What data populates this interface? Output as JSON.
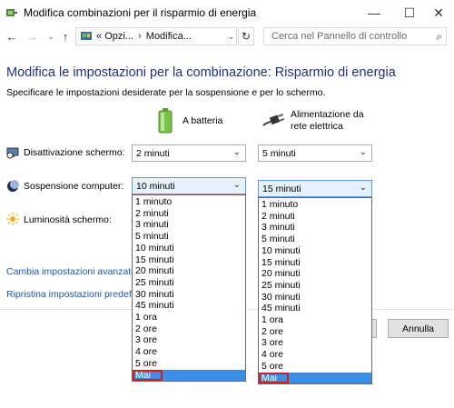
{
  "window": {
    "title": "Modifica combinazioni per il risparmio di energia",
    "minimize_glyph": "—",
    "maximize_glyph": "☐",
    "close_glyph": "✕"
  },
  "nav": {
    "back_glyph": "←",
    "forward_glyph": "→",
    "recent_glyph": "⌄",
    "up_glyph": "↑",
    "address_prefix": "«",
    "crumb1": "Opzi...",
    "crumb_sep": "›",
    "crumb2": "Modifica...",
    "address_dropdown_glyph": "⌄",
    "refresh_glyph": "↻",
    "search_placeholder": "Cerca nel Pannello di controllo",
    "search_glyph": "⌕"
  },
  "main": {
    "heading": "Modifica le impostazioni per la combinazione: Risparmio di energia",
    "subtext": "Specificare le impostazioni desiderate per la sospensione e per lo schermo.",
    "battery_label": "A batteria",
    "ac_label_line1": "Alimentazione da",
    "ac_label_line2": "rete elettrica",
    "rows": {
      "display_off": {
        "label": "Disattivazione schermo:",
        "battery": "2 minuti",
        "ac": "5 minuti"
      },
      "sleep": {
        "label": "Sospensione computer:",
        "battery": "10 minuti",
        "ac": "15 minuti"
      },
      "brightness": {
        "label": "Luminosità schermo:"
      }
    },
    "chevron": "⌄",
    "options": [
      "1 minuto",
      "2 minuti",
      "3 minuti",
      "5 minuti",
      "10 minuti",
      "15 minuti",
      "20 minuti",
      "25 minuti",
      "30 minuti",
      "45 minuti",
      "1 ora",
      "2 ore",
      "3 ore",
      "4 ore",
      "5 ore",
      "Mai"
    ],
    "selected_option": "Mai",
    "link_advanced": "Cambia impostazioni avanzate",
    "link_restore": "Ripristina impostazioni predefin",
    "cancel_button": "Annulla"
  },
  "colors": {
    "accent": "#3a8ee6",
    "heading": "#1e3287",
    "link": "#1a56b4",
    "highlight": "#d51d1d"
  }
}
